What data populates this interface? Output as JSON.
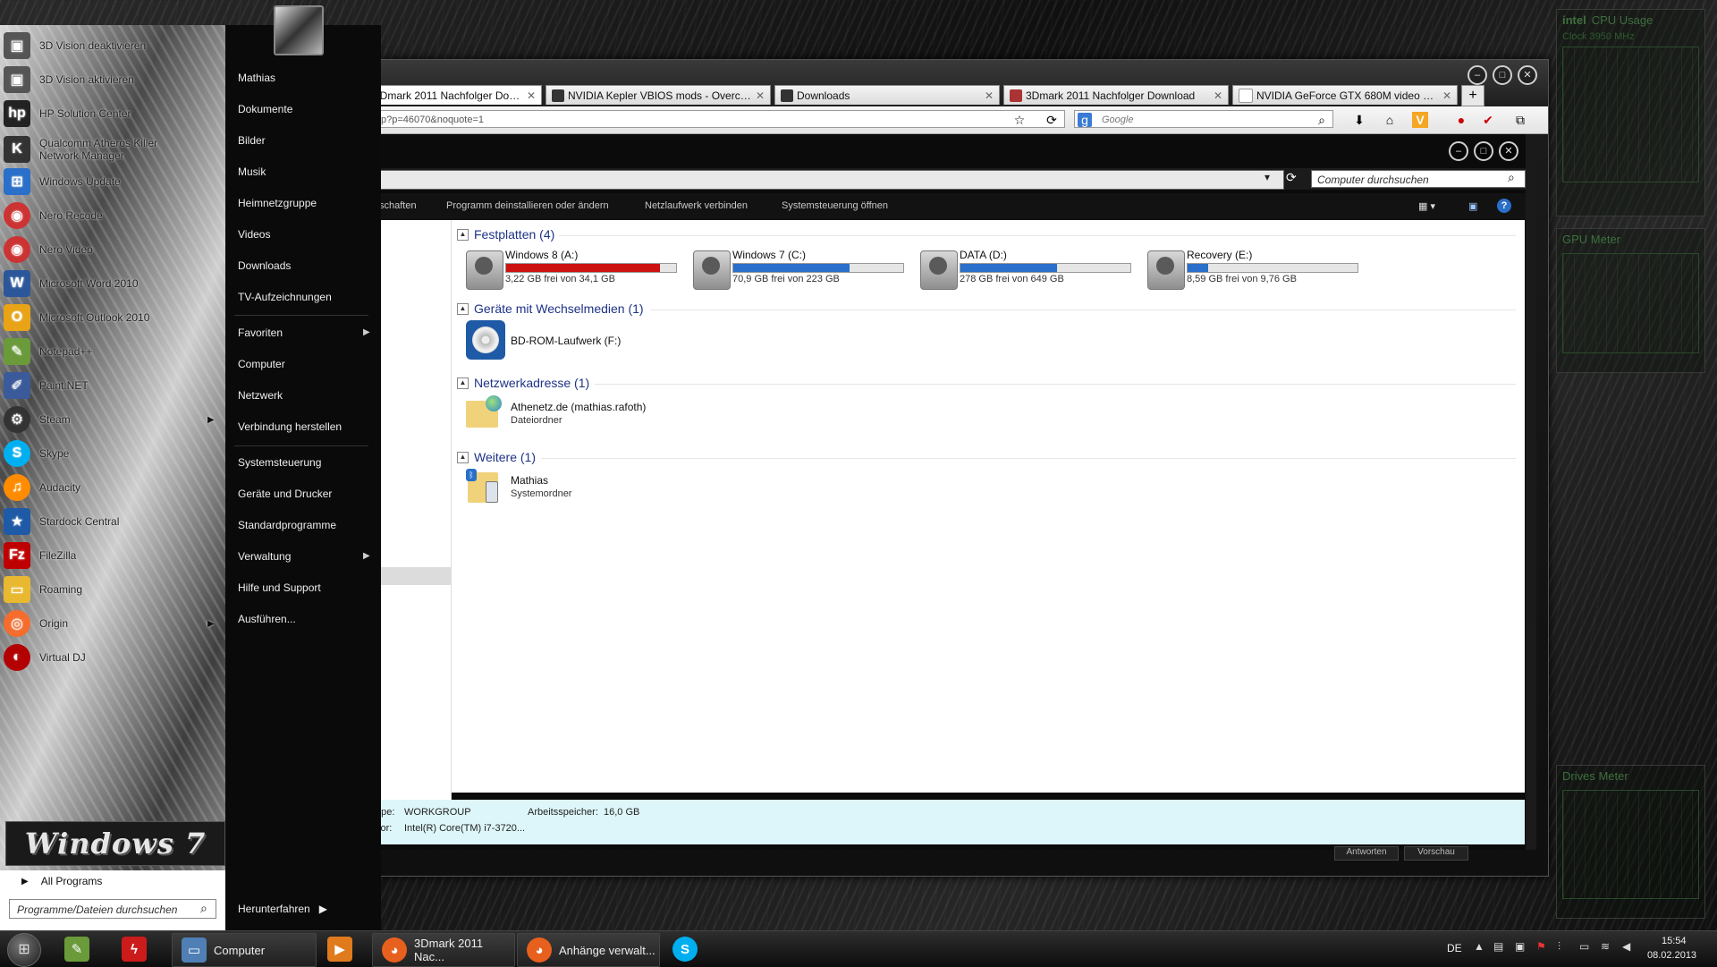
{
  "gadgets": {
    "cpu": {
      "brand": "intel",
      "title": "CPU Usage",
      "clock": "Clock 3950 MHz"
    },
    "gpu": {
      "title": "GPU Meter"
    },
    "drives": {
      "title": "Drives Meter"
    }
  },
  "browser": {
    "tabs": [
      {
        "label": "3Dmark 2011 Nachfolger Download - ...",
        "active": true
      },
      {
        "label": "NVIDIA Kepler VBIOS mods - Overclo...",
        "active": false
      },
      {
        "label": "Downloads",
        "active": false
      },
      {
        "label": "3Dmark 2011 Nachfolger Download",
        "active": false
      },
      {
        "label": "NVIDIA GeForce GTX 680M video car...",
        "active": false
      }
    ],
    "new_tab": "+",
    "url_fragment": "p?p=46070&noquote=1",
    "search_placeholder": "Google",
    "window_buttons": [
      "–",
      "□",
      "✕"
    ]
  },
  "explorer": {
    "search_placeholder": "Computer durchsuchen",
    "toolbar": {
      "item0": "schaften",
      "item1": "Programm deinstallieren oder ändern",
      "item2": "Netzlaufwerk verbinden",
      "item3": "Systemsteuerung öffnen"
    },
    "groups": {
      "festplatten": "Festplatten (4)",
      "wechselmedien": "Geräte mit Wechselmedien (1)",
      "netzwerk": "Netzwerkadresse (1)",
      "weitere": "Weitere (1)"
    },
    "drives": [
      {
        "name": "Windows 8 (A:)",
        "info": "3,22 GB frei von 34,1 GB",
        "used_fraction": 0.906,
        "color": "#cc1111"
      },
      {
        "name": "Windows 7 (C:)",
        "info": "70,9 GB frei von 223 GB",
        "used_fraction": 0.682,
        "color": "#2a6fc9"
      },
      {
        "name": "DATA (D:)",
        "info": "278 GB frei von 649 GB",
        "used_fraction": 0.571,
        "color": "#2a6fc9"
      },
      {
        "name": "Recovery (E:)",
        "info": "8,59 GB frei von 9,76 GB",
        "used_fraction": 0.12,
        "color": "#2a6fc9"
      }
    ],
    "bdrom": "BD-ROM-Laufwerk (F:)",
    "network": {
      "name": "Athenetz.de (mathias.rafoth)",
      "type": "Dateiordner"
    },
    "other": {
      "name": "Mathias",
      "type": "Systemordner"
    },
    "nav_fragment": ")",
    "details": {
      "workgroup_label": "ppe:",
      "workgroup_value": "WORKGROUP",
      "ram_label": "Arbeitsspeicher:",
      "ram_value": "16,0 GB",
      "cpu_label": "sor:",
      "cpu_value": "Intel(R) Core(TM) i7-3720..."
    },
    "behind_buttons": [
      "Antworten",
      "Vorschau"
    ]
  },
  "startmenu": {
    "programs": [
      {
        "label": "3D Vision deaktivieren",
        "icon": "nvidia-3d-icon",
        "color": "#555"
      },
      {
        "label": "3D Vision aktivieren",
        "icon": "nvidia-3d-icon",
        "color": "#555"
      },
      {
        "label": "HP Solution Center",
        "icon": "hp-icon",
        "color": "#222"
      },
      {
        "label": "Qualcomm Atheros Killer Network Manager",
        "icon": "killer-icon",
        "color": "#333"
      },
      {
        "label": "Windows Update",
        "icon": "windows-update-icon",
        "color": "#2a6fc9"
      },
      {
        "label": "Nero Recode",
        "icon": "nero-icon",
        "color": "#c33"
      },
      {
        "label": "Nero Video",
        "icon": "nero-icon",
        "color": "#c33"
      },
      {
        "label": "Microsoft Word 2010",
        "icon": "word-icon",
        "color": "#2b579a"
      },
      {
        "label": "Microsoft Outlook 2010",
        "icon": "outlook-icon",
        "color": "#e8a317"
      },
      {
        "label": "Notepad++",
        "icon": "notepad-icon",
        "color": "#6a9a3a"
      },
      {
        "label": "Paint.NET",
        "icon": "paint-icon",
        "color": "#3a5a9a"
      },
      {
        "label": "Steam",
        "icon": "steam-icon",
        "color": "#333",
        "arrow": true
      },
      {
        "label": "Skype",
        "icon": "skype-icon",
        "color": "#00aff0"
      },
      {
        "label": "Audacity",
        "icon": "audacity-icon",
        "color": "#ff8c00"
      },
      {
        "label": "Stardock Central",
        "icon": "stardock-icon",
        "color": "#1f5aa6"
      },
      {
        "label": "FileZilla",
        "icon": "filezilla-icon",
        "color": "#bf0000"
      },
      {
        "label": "Roaming",
        "icon": "folder-icon",
        "color": "#e8b830"
      },
      {
        "label": "Origin",
        "icon": "origin-icon",
        "color": "#f56c2d",
        "arrow": true
      },
      {
        "label": "Virtual DJ",
        "icon": "virtualdj-icon",
        "color": "#b30000"
      }
    ],
    "right_links": [
      {
        "label": "Mathias"
      },
      {
        "label": "Dokumente"
      },
      {
        "label": "Bilder"
      },
      {
        "label": "Musik"
      },
      {
        "label": "Heimnetzgruppe"
      },
      {
        "label": "Videos"
      },
      {
        "label": "Downloads"
      },
      {
        "label": "TV-Aufzeichnungen"
      },
      {
        "label": "Favoriten",
        "arrow": true
      },
      {
        "label": "Computer"
      },
      {
        "label": "Netzwerk"
      },
      {
        "label": "Verbindung herstellen"
      },
      {
        "label": "Systemsteuerung"
      },
      {
        "label": "Geräte und Drucker"
      },
      {
        "label": "Standardprogramme"
      },
      {
        "label": "Verwaltung",
        "arrow": true
      },
      {
        "label": "Hilfe und Support"
      },
      {
        "label": "Ausführen..."
      }
    ],
    "logo_text": "Windows 7",
    "all_programs": "All Programs",
    "search_placeholder": "Programme/Dateien durchsuchen",
    "shutdown": "Herunterfahren"
  },
  "taskbar": {
    "items": [
      {
        "label": "",
        "icon": "notepad-icon",
        "color": "#6a9a3a"
      },
      {
        "label": "",
        "icon": "flash-icon",
        "color": "#cc1b1b"
      },
      {
        "label": "Computer",
        "icon": "computer-icon",
        "color": "#4f7fb5"
      },
      {
        "label": "",
        "icon": "media-player-icon",
        "color": "#e07b1d"
      },
      {
        "label": "3Dmark 2011 Nac...",
        "icon": "firefox-icon",
        "color": "#e8601d"
      },
      {
        "label": "Anhänge verwalt...",
        "icon": "firefox-icon",
        "color": "#e8601d"
      },
      {
        "label": "",
        "icon": "skype-icon",
        "color": "#00aff0"
      }
    ],
    "lang": "DE",
    "time": "15:54",
    "date": "08.02.2013"
  }
}
